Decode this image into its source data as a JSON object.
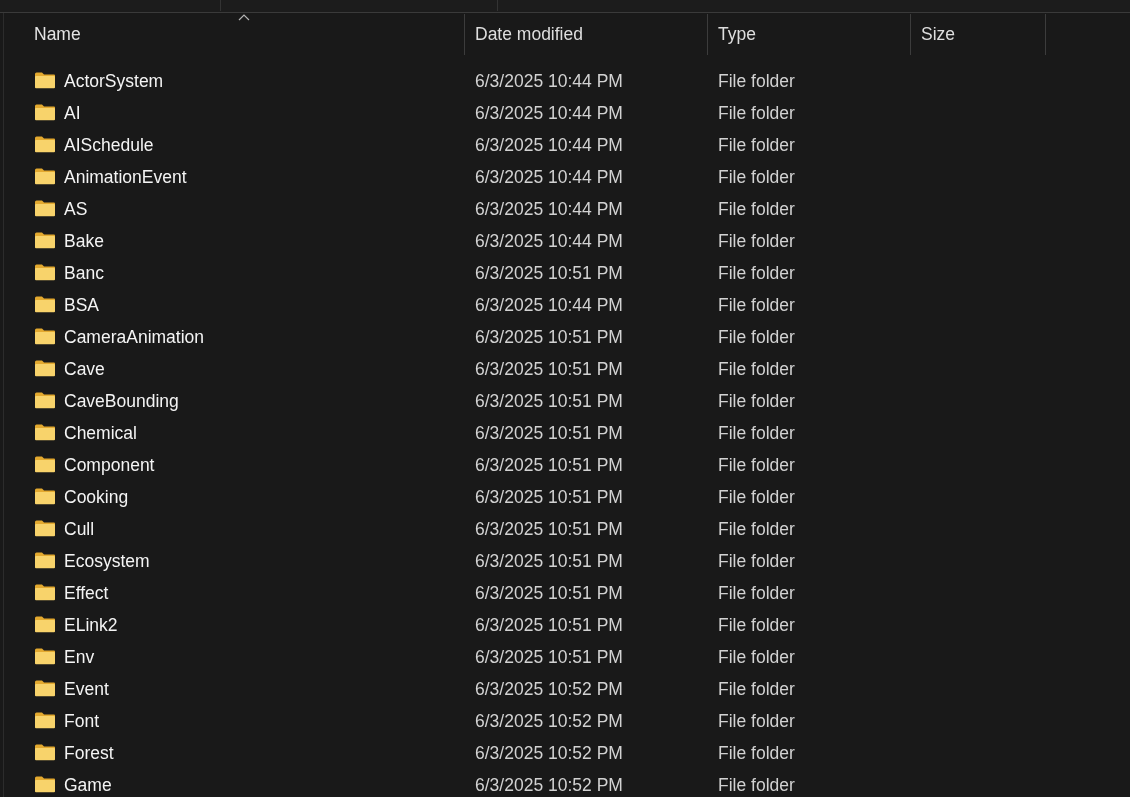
{
  "table": {
    "columns": [
      {
        "label": "Name",
        "sorted": true
      },
      {
        "label": "Date modified",
        "sorted": false
      },
      {
        "label": "Type",
        "sorted": false
      },
      {
        "label": "Size",
        "sorted": false
      }
    ],
    "rows": [
      {
        "name": "ActorSystem",
        "date_modified": "6/3/2025 10:44 PM",
        "type": "File folder"
      },
      {
        "name": "AI",
        "date_modified": "6/3/2025 10:44 PM",
        "type": "File folder"
      },
      {
        "name": "AISchedule",
        "date_modified": "6/3/2025 10:44 PM",
        "type": "File folder"
      },
      {
        "name": "AnimationEvent",
        "date_modified": "6/3/2025 10:44 PM",
        "type": "File folder"
      },
      {
        "name": "AS",
        "date_modified": "6/3/2025 10:44 PM",
        "type": "File folder"
      },
      {
        "name": "Bake",
        "date_modified": "6/3/2025 10:44 PM",
        "type": "File folder"
      },
      {
        "name": "Banc",
        "date_modified": "6/3/2025 10:51 PM",
        "type": "File folder"
      },
      {
        "name": "BSA",
        "date_modified": "6/3/2025 10:44 PM",
        "type": "File folder"
      },
      {
        "name": "CameraAnimation",
        "date_modified": "6/3/2025 10:51 PM",
        "type": "File folder"
      },
      {
        "name": "Cave",
        "date_modified": "6/3/2025 10:51 PM",
        "type": "File folder"
      },
      {
        "name": "CaveBounding",
        "date_modified": "6/3/2025 10:51 PM",
        "type": "File folder"
      },
      {
        "name": "Chemical",
        "date_modified": "6/3/2025 10:51 PM",
        "type": "File folder"
      },
      {
        "name": "Component",
        "date_modified": "6/3/2025 10:51 PM",
        "type": "File folder"
      },
      {
        "name": "Cooking",
        "date_modified": "6/3/2025 10:51 PM",
        "type": "File folder"
      },
      {
        "name": "Cull",
        "date_modified": "6/3/2025 10:51 PM",
        "type": "File folder"
      },
      {
        "name": "Ecosystem",
        "date_modified": "6/3/2025 10:51 PM",
        "type": "File folder"
      },
      {
        "name": "Effect",
        "date_modified": "6/3/2025 10:51 PM",
        "type": "File folder"
      },
      {
        "name": "ELink2",
        "date_modified": "6/3/2025 10:51 PM",
        "type": "File folder"
      },
      {
        "name": "Env",
        "date_modified": "6/3/2025 10:51 PM",
        "type": "File folder"
      },
      {
        "name": "Event",
        "date_modified": "6/3/2025 10:52 PM",
        "type": "File folder"
      },
      {
        "name": "Font",
        "date_modified": "6/3/2025 10:52 PM",
        "type": "File folder"
      },
      {
        "name": "Forest",
        "date_modified": "6/3/2025 10:52 PM",
        "type": "File folder"
      },
      {
        "name": "Game",
        "date_modified": "6/3/2025 10:52 PM",
        "type": "File folder"
      }
    ]
  }
}
